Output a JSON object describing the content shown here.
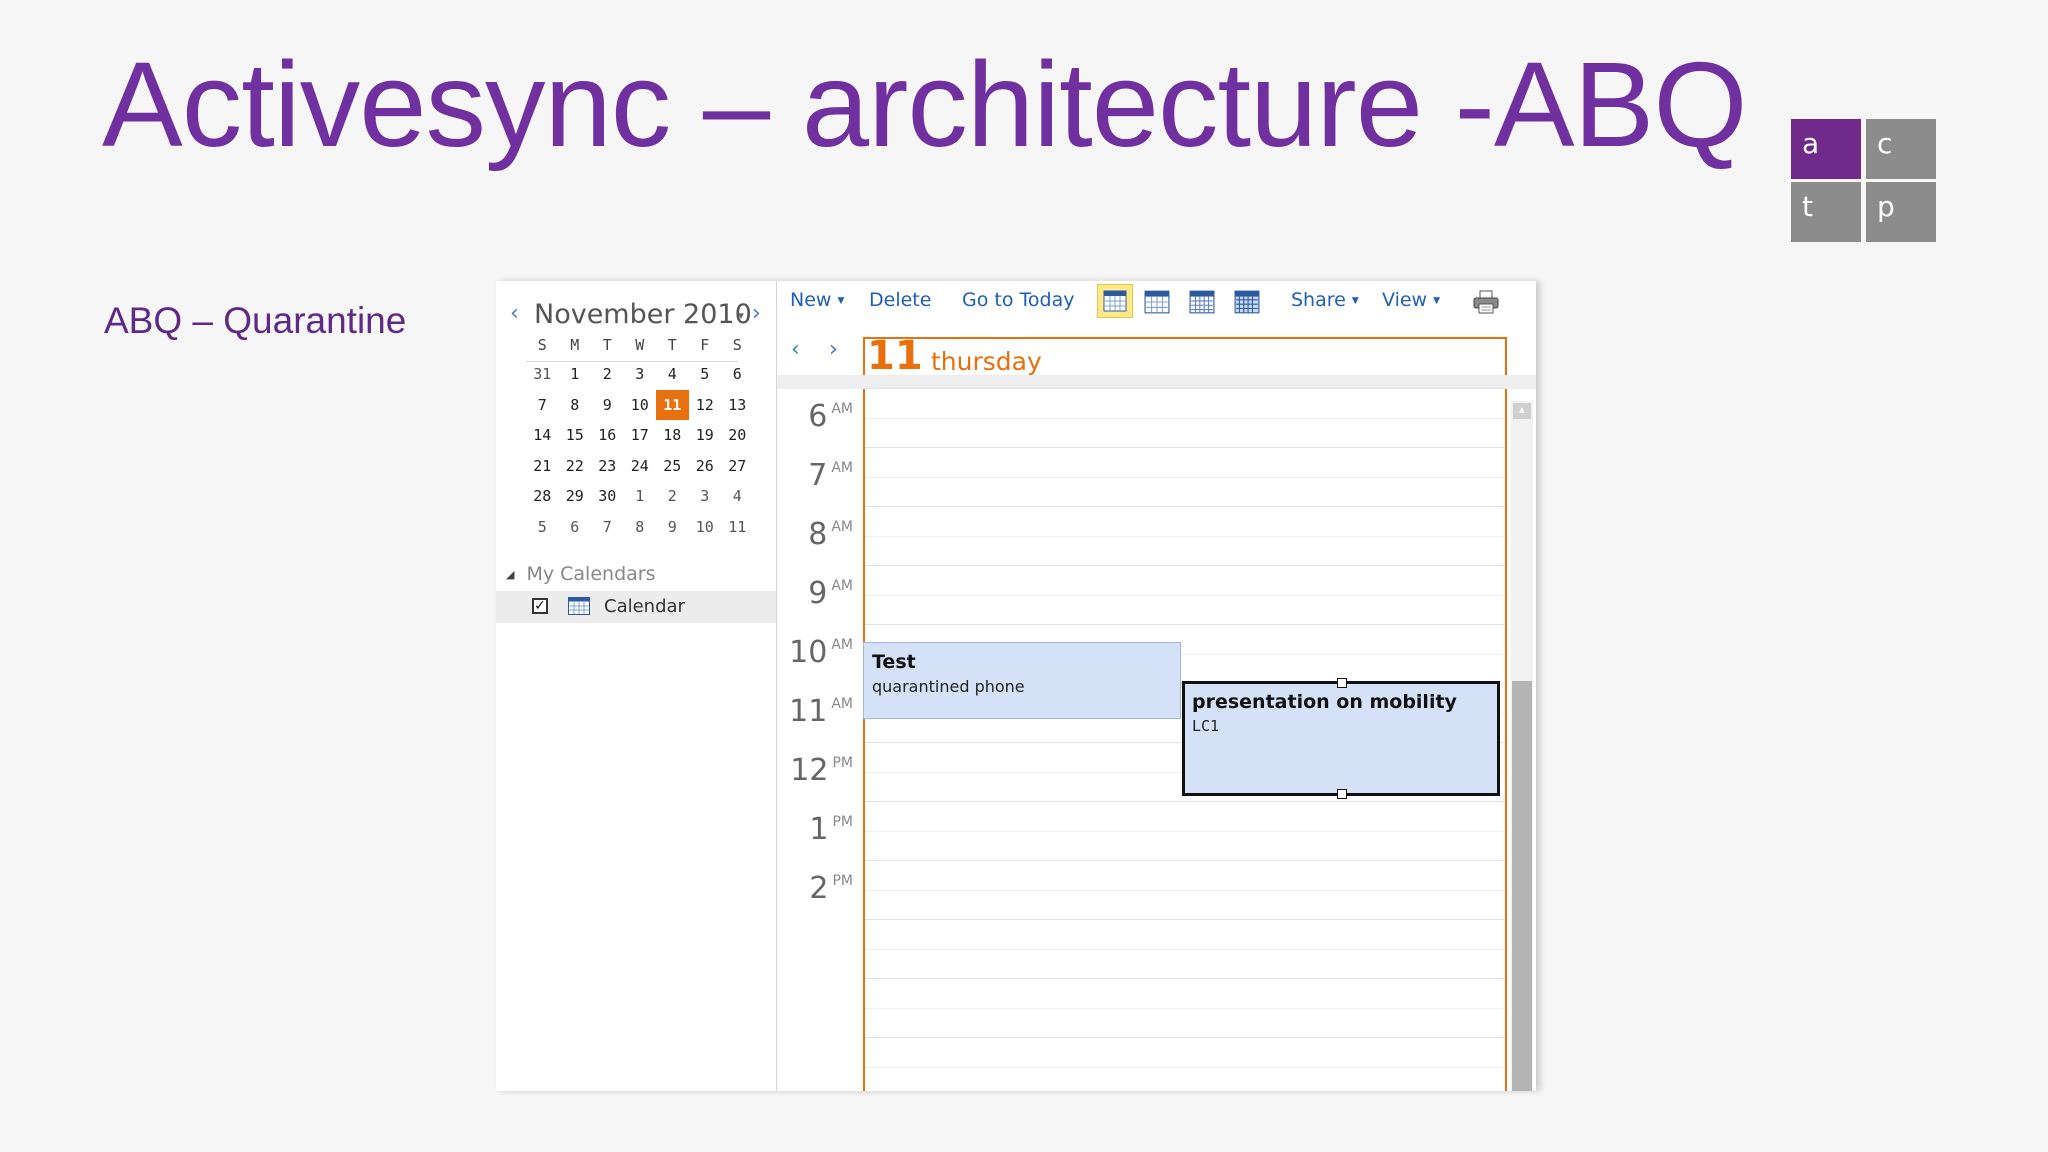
{
  "slide": {
    "title": "Activesync – architecture -ABQ",
    "subtitle": "ABQ – Quarantine",
    "logo": [
      "a",
      "c",
      "t",
      "p"
    ]
  },
  "mini_calendar": {
    "month_label": "November 2010",
    "weekdays": [
      "S",
      "M",
      "T",
      "W",
      "T",
      "F",
      "S"
    ],
    "weeks": [
      [
        "31",
        "1",
        "2",
        "3",
        "4",
        "5",
        "6"
      ],
      [
        "7",
        "8",
        "9",
        "10",
        "11",
        "12",
        "13"
      ],
      [
        "14",
        "15",
        "16",
        "17",
        "18",
        "19",
        "20"
      ],
      [
        "21",
        "22",
        "23",
        "24",
        "25",
        "26",
        "27"
      ],
      [
        "28",
        "29",
        "30",
        "1",
        "2",
        "3",
        "4"
      ],
      [
        "5",
        "6",
        "7",
        "8",
        "9",
        "10",
        "11"
      ]
    ],
    "selected": "11"
  },
  "calendars": {
    "group_label": "My Calendars",
    "items": [
      {
        "label": "Calendar",
        "checked": true
      }
    ]
  },
  "toolbar": {
    "new_label": "New",
    "delete_label": "Delete",
    "today_label": "Go to Today",
    "share_label": "Share",
    "view_label": "View"
  },
  "day_view": {
    "day_number": "11",
    "day_name": "thursday",
    "hours": [
      {
        "h": "6",
        "ap": "AM"
      },
      {
        "h": "7",
        "ap": "AM"
      },
      {
        "h": "8",
        "ap": "AM"
      },
      {
        "h": "9",
        "ap": "AM"
      },
      {
        "h": "10",
        "ap": "AM"
      },
      {
        "h": "11",
        "ap": "AM"
      },
      {
        "h": "12",
        "ap": "PM"
      },
      {
        "h": "1",
        "ap": "PM"
      },
      {
        "h": "2",
        "ap": "PM"
      }
    ],
    "events": [
      {
        "title": "Test",
        "detail": "quarantined phone"
      },
      {
        "title": "presentation on mobility",
        "detail": "LC1"
      }
    ]
  },
  "colors": {
    "title_purple": "#7030a0",
    "accent_orange": "#e8700e",
    "link_blue": "#1f5fb8",
    "event_fill": "#d4e1f7"
  }
}
